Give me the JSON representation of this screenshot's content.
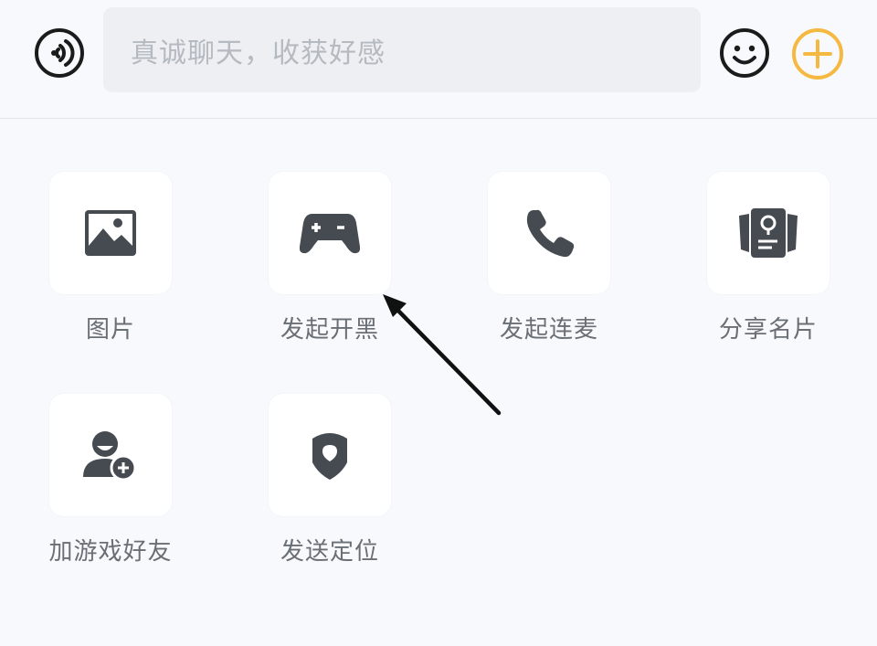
{
  "input_bar": {
    "placeholder": "真诚聊天，收获好感",
    "voice_icon": "voice-wave-icon",
    "emoji_icon": "smiley-icon",
    "plus_icon": "plus-circle-icon",
    "plus_color": "#f5b942"
  },
  "actions": [
    {
      "label": "图片",
      "icon": "image-icon"
    },
    {
      "label": "发起开黑",
      "icon": "gamepad-icon"
    },
    {
      "label": "发起连麦",
      "icon": "phone-icon"
    },
    {
      "label": "分享名片",
      "icon": "id-card-icon"
    },
    {
      "label": "加游戏好友",
      "icon": "add-friend-icon"
    },
    {
      "label": "发送定位",
      "icon": "location-shield-icon"
    }
  ],
  "icon_color": "#454b50",
  "annotation": {
    "type": "arrow",
    "points_to": "发起开黑",
    "color": "#111111"
  }
}
